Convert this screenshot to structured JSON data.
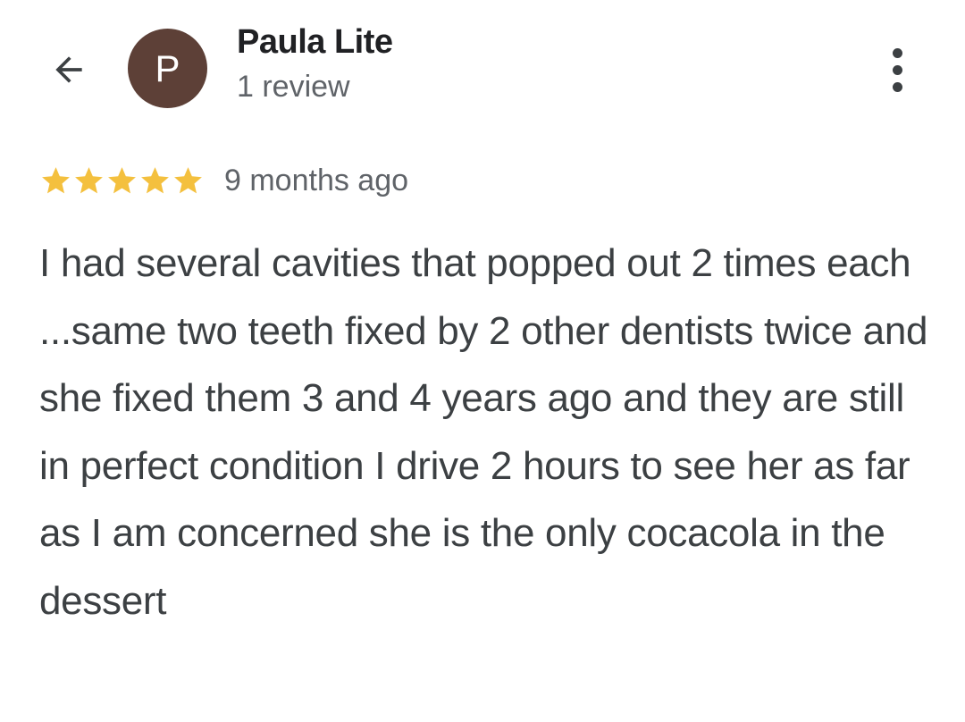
{
  "header": {
    "back_icon": "arrow-left-icon",
    "avatar_initial": "P",
    "avatar_color": "#5d4037",
    "author_name": "Paula Lite",
    "review_count": "1 review",
    "more_icon": "more-vert-icon"
  },
  "review": {
    "rating": 5,
    "max_rating": 5,
    "star_color": "#f4c03e",
    "date": "9 months ago",
    "text": "I had several cavities that popped out 2 times each ...same two teeth fixed by 2 other dentists twice and she fixed them 3 and 4 years ago and they are still in perfect condition I drive 2 hours to see her as far as I am concerned she is the only cocacola in the dessert"
  }
}
